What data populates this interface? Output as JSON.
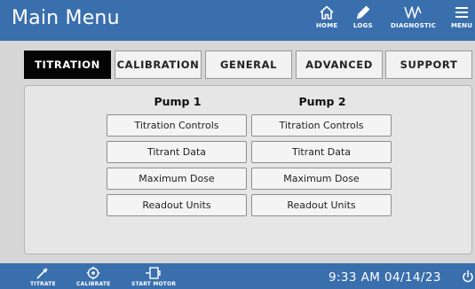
{
  "header": {
    "title": "Main Menu",
    "nav": [
      {
        "label": "HOME",
        "icon": "home-icon"
      },
      {
        "label": "LOGS",
        "icon": "pen-icon"
      },
      {
        "label": "DIAGNOSTIC",
        "icon": "diagnostic-wave-icon"
      },
      {
        "label": "MENU",
        "icon": "hamburger-menu-icon"
      }
    ]
  },
  "tabs": [
    {
      "label": "TITRATION",
      "active": true
    },
    {
      "label": "CALIBRATION",
      "active": false
    },
    {
      "label": "GENERAL",
      "active": false
    },
    {
      "label": "ADVANCED",
      "active": false
    },
    {
      "label": "SUPPORT",
      "active": false
    }
  ],
  "pumps": [
    {
      "title": "Pump 1",
      "buttons": [
        "Titration Controls",
        "Titrant Data",
        "Maximum Dose",
        "Readout Units"
      ]
    },
    {
      "title": "Pump 2",
      "buttons": [
        "Titration Controls",
        "Titrant Data",
        "Maximum Dose",
        "Readout Units"
      ]
    }
  ],
  "footer": {
    "actions": [
      {
        "label": "TITRATE",
        "icon": "pipette-icon"
      },
      {
        "label": "CALIBRATE",
        "icon": "calibrate-target-icon"
      },
      {
        "label": "START MOTOR",
        "icon": "motor-icon"
      }
    ],
    "time": "9:33 AM",
    "date": "04/14/23",
    "power_icon": "power-icon"
  },
  "colors": {
    "header_bg": "#3a6fae",
    "active_tab_bg": "#050505",
    "page_bg": "#d6d6d6",
    "panel_bg": "#e6e6e6"
  }
}
